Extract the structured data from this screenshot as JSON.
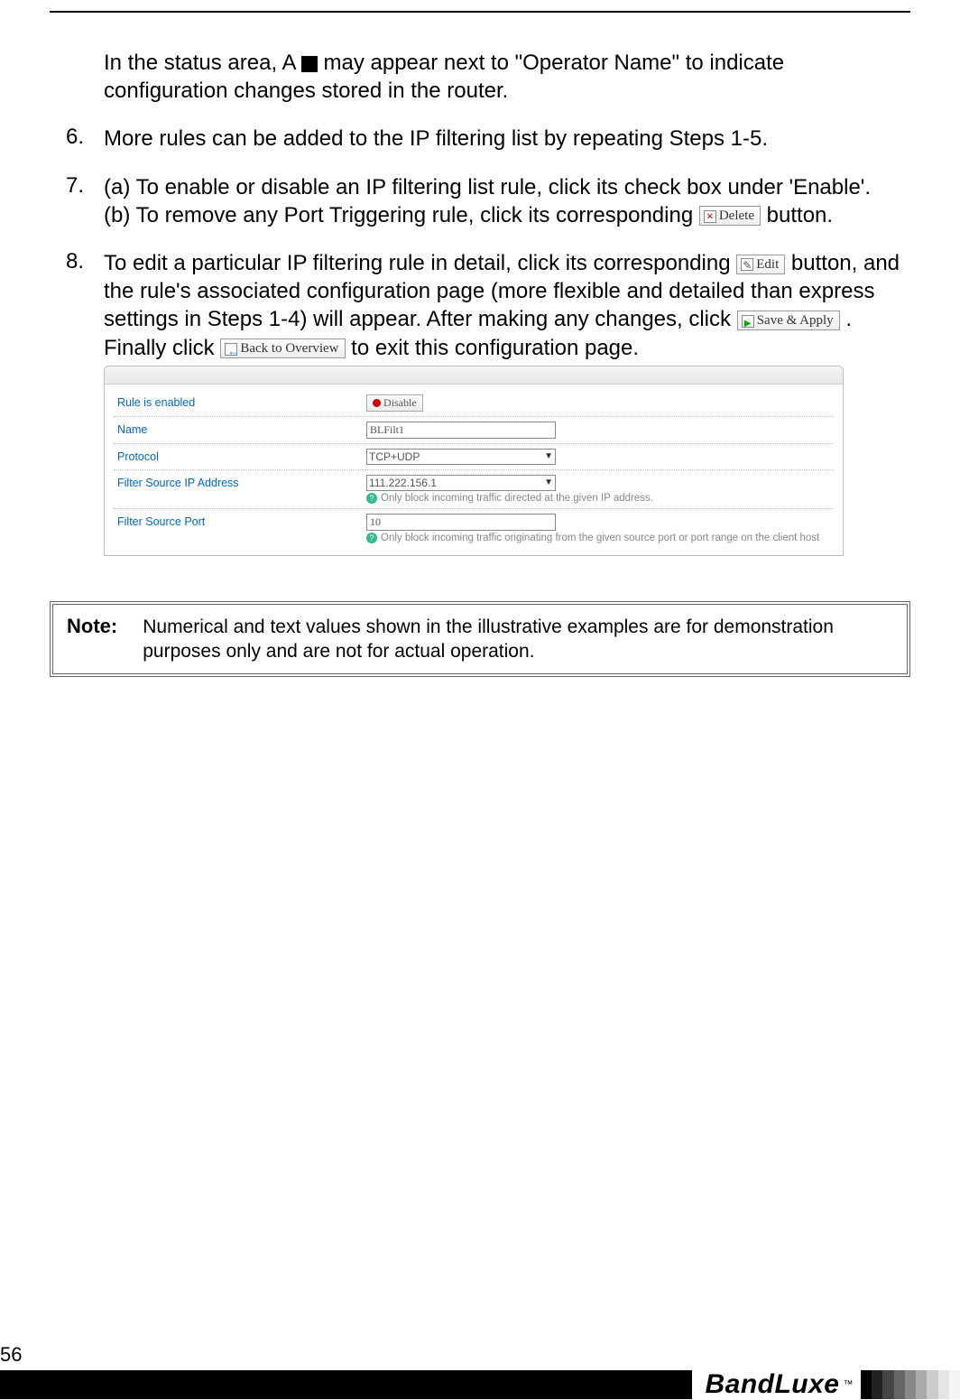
{
  "page_number": "56",
  "logo": "BandLuxe",
  "logo_tm": "™",
  "intro": {
    "line1_a": "In the status area, A ",
    "line1_b": " may appear next to \"Operator Name\" to indicate configuration changes stored in the router."
  },
  "steps": {
    "s6": {
      "num": "6.",
      "text": "More rules can be added to the IP filtering list by repeating Steps 1-5."
    },
    "s7": {
      "num": "7.",
      "a": "(a) To enable or disable an IP filtering list rule, click its check box under 'Enable'.",
      "b_pre": "(b) To remove any Port Triggering rule, click its corresponding ",
      "b_post": " button."
    },
    "s8": {
      "num": "8.",
      "t1": "To edit a particular IP filtering rule in detail, click its corresponding ",
      "t2": " button, and the rule's associated configuration page (more flexible and detailed than express settings in Steps 1-4) will appear. After making any changes, click ",
      "t3": ". Finally click ",
      "t4": " to exit this configuration page."
    }
  },
  "buttons": {
    "delete": "Delete",
    "edit": "Edit",
    "save_apply": "Save & Apply",
    "back_overview": "Back to Overview",
    "disable": "Disable"
  },
  "form": {
    "rule_enabled": {
      "label": "Rule is enabled"
    },
    "name": {
      "label": "Name",
      "value": "BLFilt1"
    },
    "protocol": {
      "label": "Protocol",
      "value": "TCP+UDP"
    },
    "src_ip": {
      "label": "Filter Source IP Address",
      "value": "111.222.156.1",
      "hint": "Only block incoming traffic directed at the given IP address."
    },
    "src_port": {
      "label": "Filter Source Port",
      "value": "10",
      "hint": "Only block incoming traffic originating from the given source port or port range on the client host"
    }
  },
  "note": {
    "label": "Note:",
    "text": "Numerical and text values shown in the illustrative examples are for demonstration purposes only and are not for actual operation."
  }
}
